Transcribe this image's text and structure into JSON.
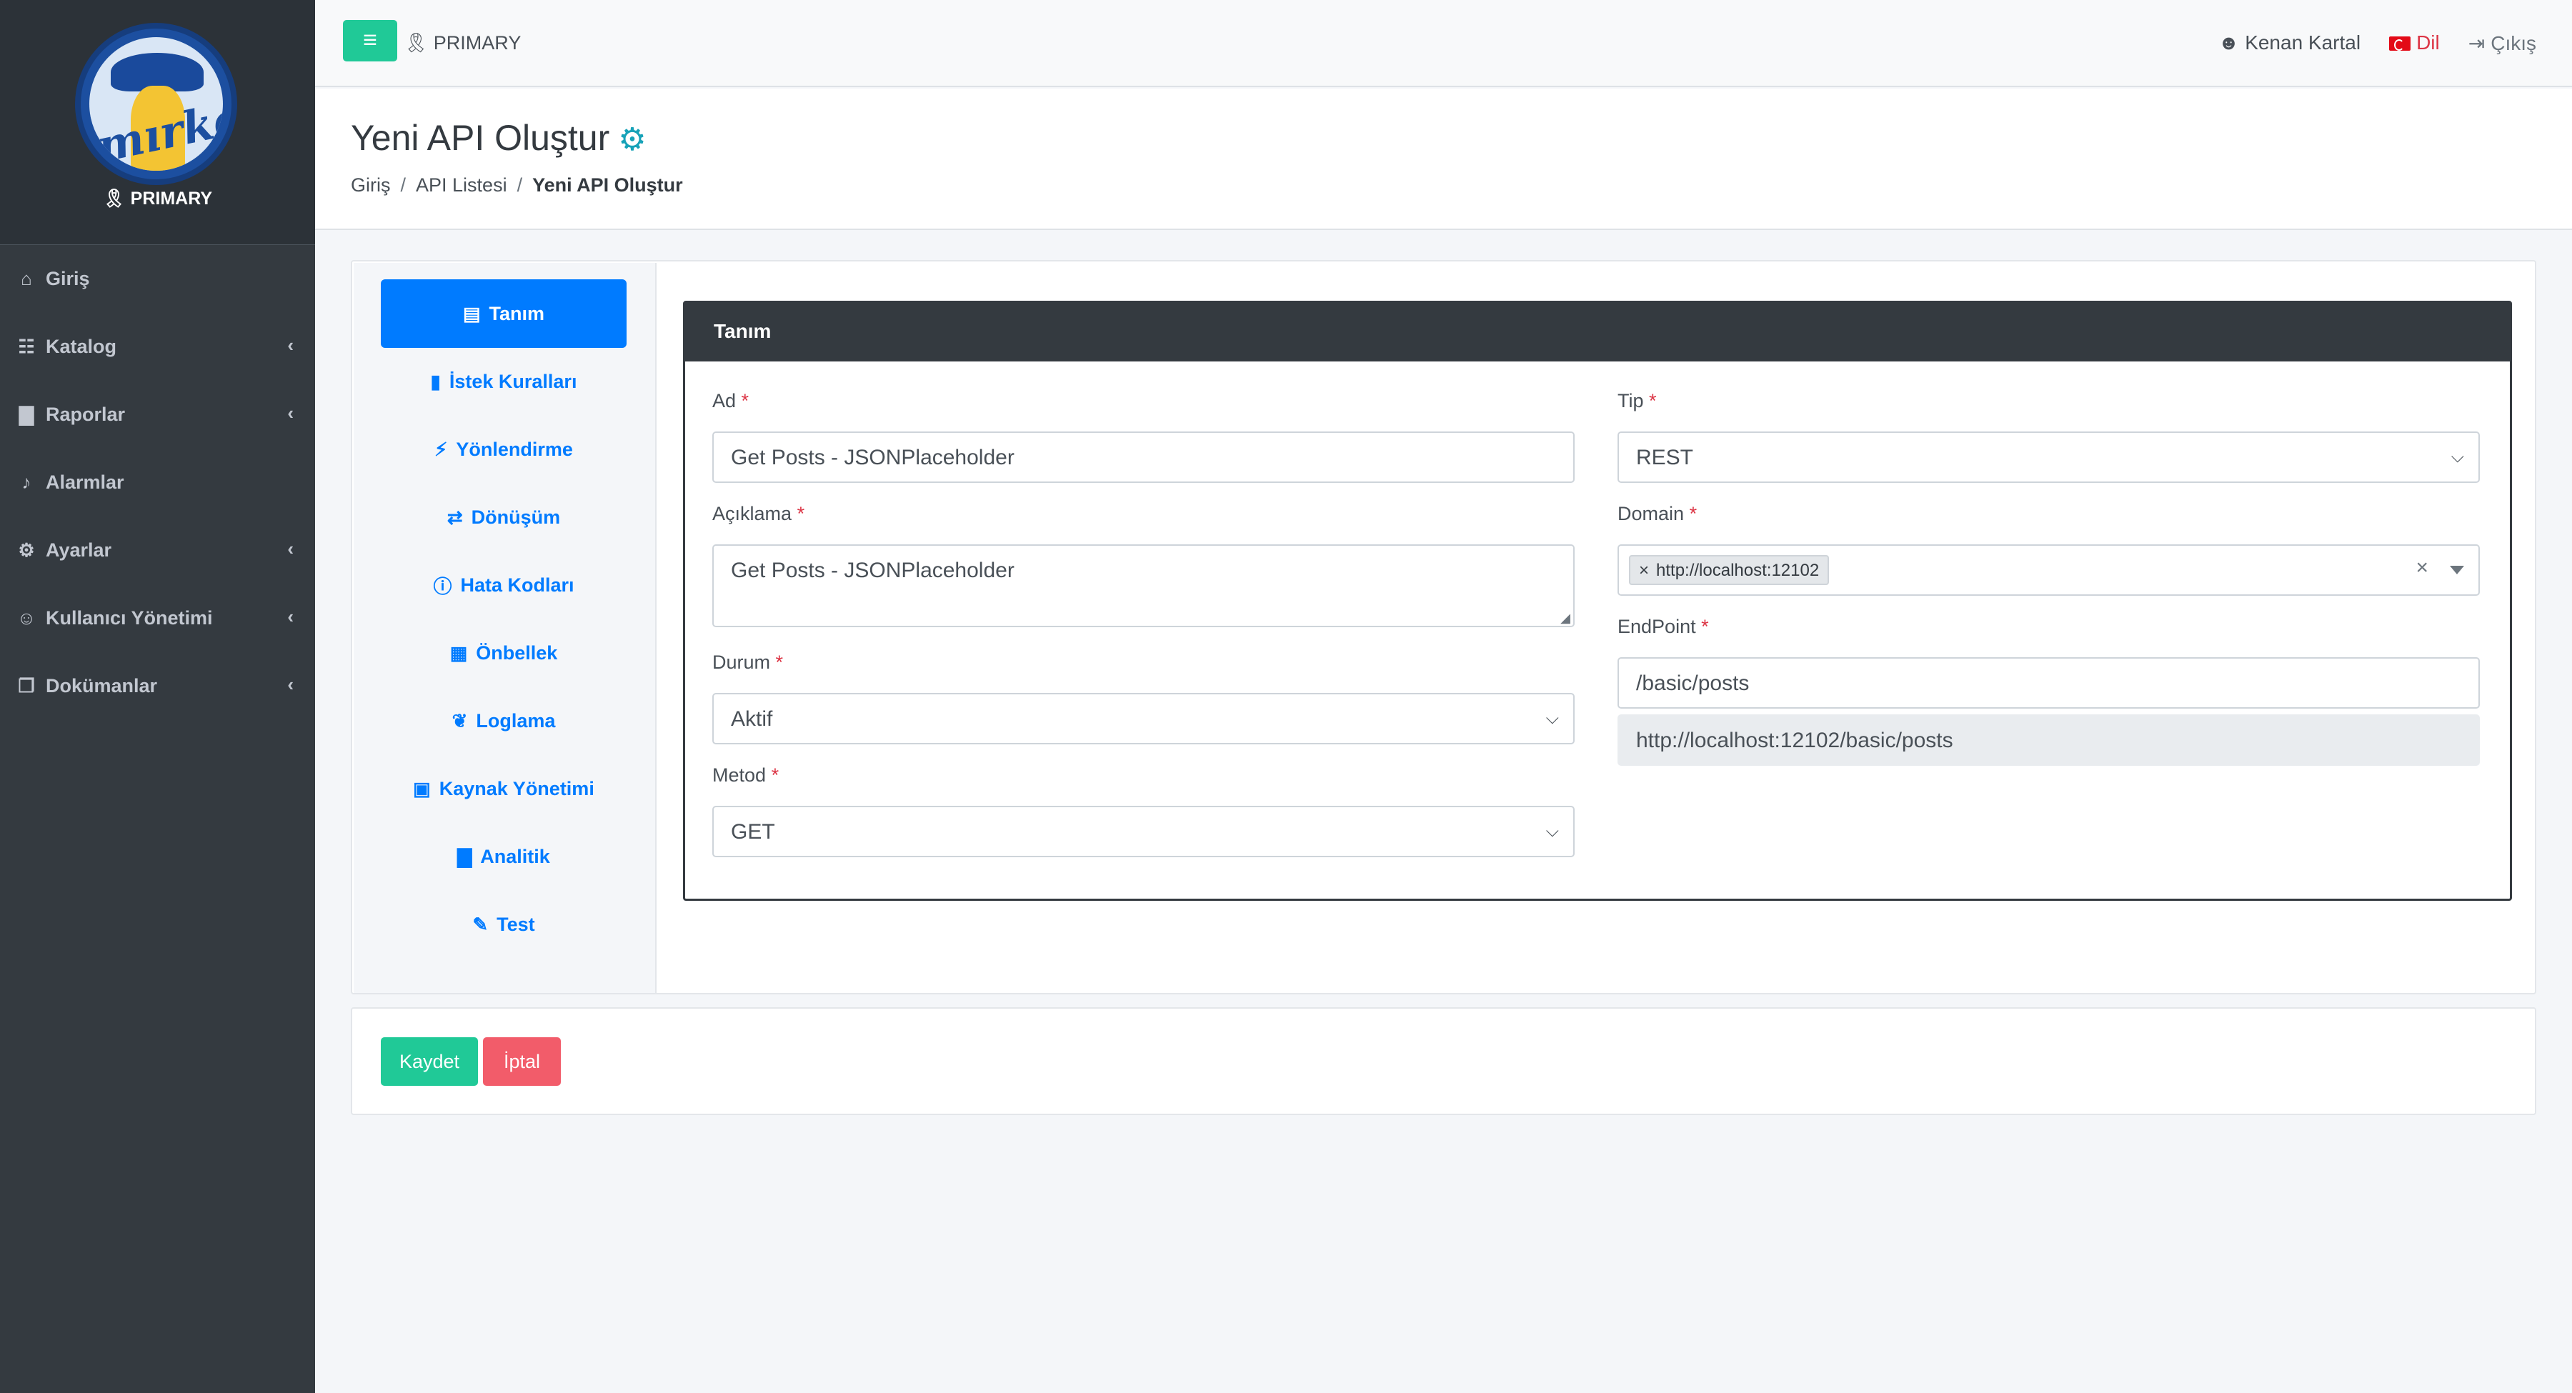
{
  "brand": {
    "logo_text": "mırket",
    "role": "PRIMARY"
  },
  "sidebar": {
    "items": [
      {
        "label": "Giriş",
        "icon": "home-icon",
        "has_chevron": false
      },
      {
        "label": "Katalog",
        "icon": "sitemap-icon",
        "has_chevron": true
      },
      {
        "label": "Raporlar",
        "icon": "chart-icon",
        "has_chevron": true
      },
      {
        "label": "Alarmlar",
        "icon": "bell-icon",
        "has_chevron": false
      },
      {
        "label": "Ayarlar",
        "icon": "cogs-icon",
        "has_chevron": true
      },
      {
        "label": "Kullanıcı Yönetimi",
        "icon": "users-icon",
        "has_chevron": true
      },
      {
        "label": "Dokümanlar",
        "icon": "file-icon",
        "has_chevron": true
      }
    ]
  },
  "topbar": {
    "role": "PRIMARY",
    "user": "Kenan Kartal",
    "language": "Dil",
    "logout": "Çıkış"
  },
  "header": {
    "title": "Yeni API Oluştur",
    "breadcrumb": [
      "Giriş",
      "API Listesi",
      "Yeni API Oluştur"
    ]
  },
  "tabs": [
    {
      "label": "Tanım",
      "icon": "id-card-icon",
      "active": true
    },
    {
      "label": "İstek Kuralları",
      "icon": "document-icon",
      "active": false
    },
    {
      "label": "Yönlendirme",
      "icon": "bolt-icon",
      "active": false
    },
    {
      "label": "Dönüşüm",
      "icon": "exchange-icon",
      "active": false
    },
    {
      "label": "Hata Kodları",
      "icon": "exclamation-icon",
      "active": false
    },
    {
      "label": "Önbellek",
      "icon": "memory-icon",
      "active": false
    },
    {
      "label": "Loglama",
      "icon": "leaf-icon",
      "active": false
    },
    {
      "label": "Kaynak Yönetimi",
      "icon": "lock-icon",
      "active": false
    },
    {
      "label": "Analitik",
      "icon": "chart-icon",
      "active": false
    },
    {
      "label": "Test",
      "icon": "pen-icon",
      "active": false
    }
  ],
  "form": {
    "panel_title": "Tanım",
    "ad": {
      "label": "Ad",
      "value": "Get Posts - JSONPlaceholder"
    },
    "aciklama": {
      "label": "Açıklama",
      "value": "Get Posts - JSONPlaceholder"
    },
    "durum": {
      "label": "Durum",
      "value": "Aktif"
    },
    "metod": {
      "label": "Metod",
      "value": "GET"
    },
    "tip": {
      "label": "Tip",
      "value": "REST"
    },
    "domain": {
      "label": "Domain",
      "tag": "http://localhost:12102"
    },
    "endpoint": {
      "label": "EndPoint",
      "value": "/basic/posts",
      "full_url": "http://localhost:12102/basic/posts"
    },
    "required_mark": "*"
  },
  "actions": {
    "save": "Kaydet",
    "cancel": "İptal"
  },
  "colors": {
    "sidebar": "#343a40",
    "accent_green": "#20c997",
    "primary_blue": "#007bff",
    "danger": "#f25c6a"
  }
}
